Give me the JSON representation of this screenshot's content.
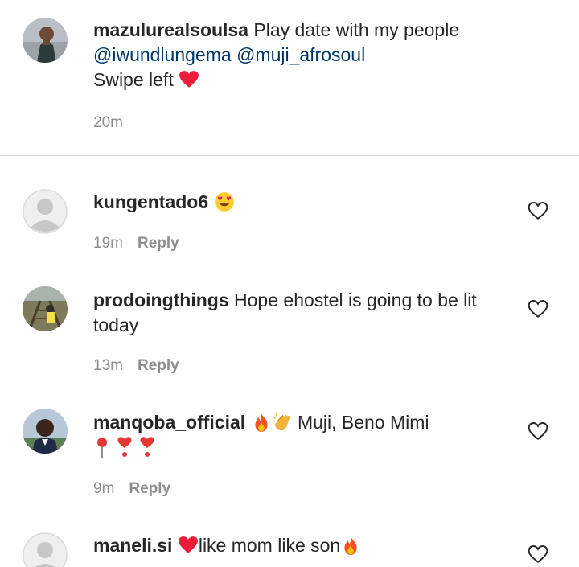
{
  "caption": {
    "username": "mazulurealsoulsa",
    "text_line1": "Play date with my people",
    "mention1": "@iwundlungema",
    "mention2": "@muji_afrosoul",
    "text_line3": "Swipe left",
    "time": "20m"
  },
  "comments": [
    {
      "username": "kungentado6",
      "text": "",
      "time": "19m",
      "reply_label": "Reply"
    },
    {
      "username": "prodoingthings",
      "text": "Hope ehostel is going to be lit",
      "text2": "today",
      "time": "13m",
      "reply_label": "Reply"
    },
    {
      "username": "manqoba_official",
      "text": "Muji, Beno Mimi",
      "time": "9m",
      "reply_label": "Reply"
    },
    {
      "username": "maneli.si",
      "text": "like mom like son",
      "time": "",
      "reply_label": ""
    }
  ],
  "icons": {
    "heart": "heart-icon",
    "like_outline": "heart-outline-icon"
  },
  "colors": {
    "mention": "#00376b",
    "meta": "#8e8e8e",
    "heart": "#ed1c3b"
  }
}
